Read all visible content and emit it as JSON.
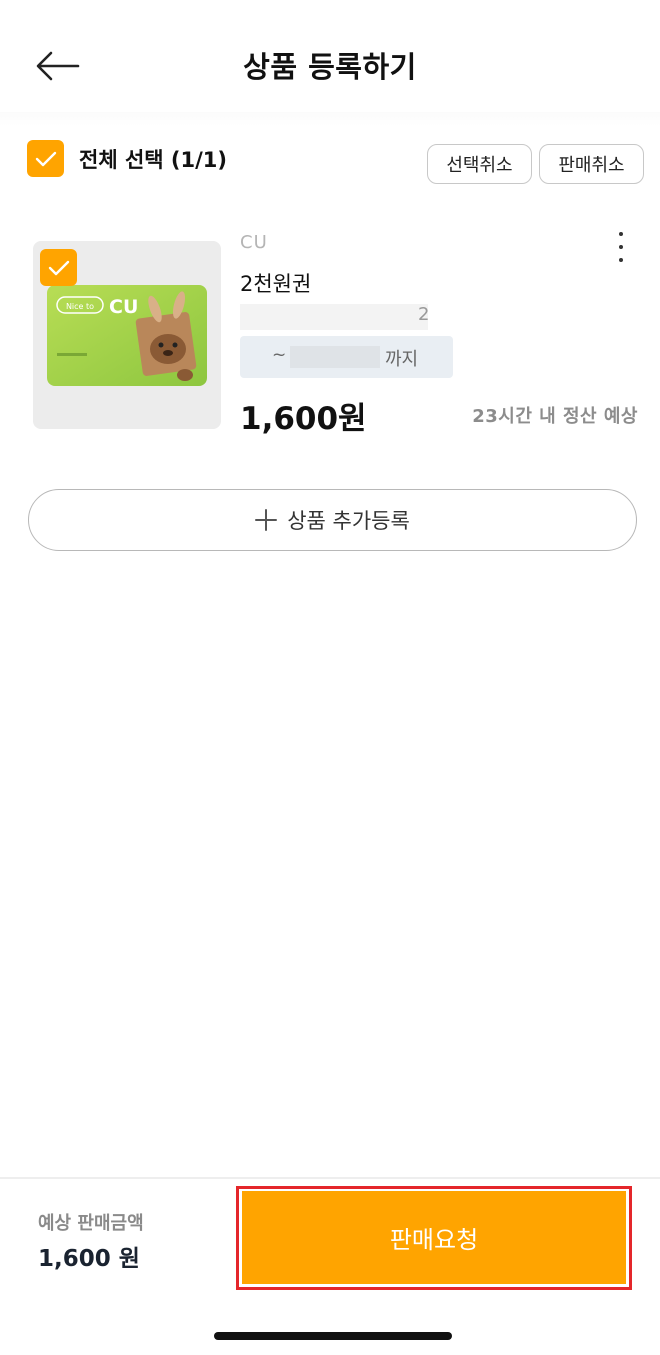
{
  "header": {
    "title": "상품 등록하기",
    "back_icon": "arrow-left-icon"
  },
  "selection": {
    "select_all_label": "전체 선택 (1/1)",
    "checked": true,
    "cancel_selection_label": "선택취소",
    "cancel_sale_label": "판매취소"
  },
  "product": {
    "brand": "CU",
    "name": "2천원권",
    "code_fragment": "2",
    "expiry_prefix": "~",
    "expiry_suffix": "까지",
    "price": "1,600원",
    "settlement": "23시간 내 정산 예상",
    "card_logo": "CU",
    "card_tag": "Nice to",
    "menu_icon": "more-vertical-icon",
    "checked": true
  },
  "add_product": {
    "label": "상품 추가등록",
    "icon": "plus-icon"
  },
  "footer": {
    "total_label": "예상 판매금액",
    "total_value": "1,600 원",
    "submit_label": "판매요청"
  },
  "colors": {
    "accent": "#ffa400",
    "highlight_frame": "#e4262a",
    "card_green": "#9fd04a"
  }
}
